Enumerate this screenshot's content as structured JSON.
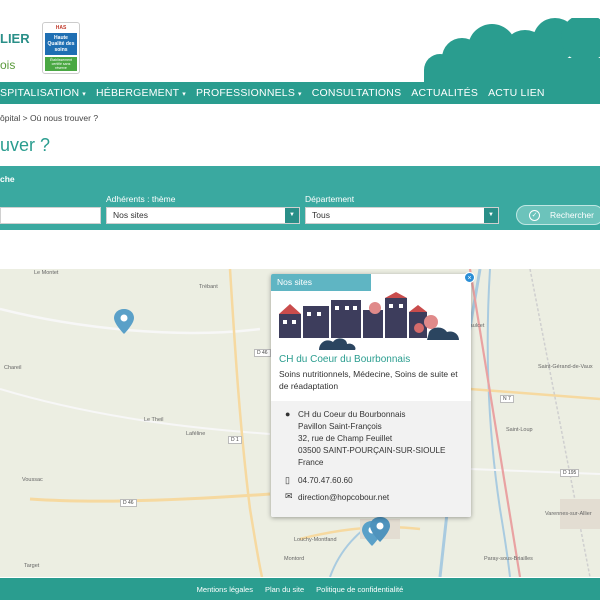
{
  "header": {
    "logo_line1": "LIER",
    "logo_line2": "ois",
    "has_badge": {
      "top": "HAS",
      "middle": "Haute Qualité des soins",
      "bottom": "Établissement certifié sans réserve"
    }
  },
  "nav": {
    "items": [
      {
        "label": "SPITALISATION",
        "has_caret": true
      },
      {
        "label": "HÉBERGEMENT",
        "has_caret": true
      },
      {
        "label": "PROFESSIONNELS",
        "has_caret": true
      },
      {
        "label": "CONSULTATIONS",
        "has_caret": false
      },
      {
        "label": "ACTUALITÉS",
        "has_caret": false
      },
      {
        "label": "ACTU LIEN",
        "has_caret": false
      }
    ],
    "caret": "▾"
  },
  "breadcrumb": "ôpital > Où nous trouver ?",
  "page_title": "uver ?",
  "search": {
    "panel_label": "che",
    "field1": {
      "value": ""
    },
    "field2": {
      "label": "Adhérents : thème",
      "value": "Nos sites"
    },
    "field3": {
      "label": "Département",
      "value": "Tous"
    },
    "button_label": "Rechercher"
  },
  "map": {
    "labels": [
      "Le Montet",
      "Trébant",
      "Chareil",
      "Le Theil",
      "Laféline",
      "Voussac",
      "Louchy-Montfand",
      "Montord",
      "Target",
      "Saulcet",
      "Saint-Loup",
      "Paray-sous-Briailles",
      "Varennes-sur-Allier",
      "Saint-Gérand-de-Vaux"
    ],
    "roads": [
      "D 1",
      "D 46",
      "N 7",
      "D 195",
      "D 46"
    ]
  },
  "popup": {
    "tag": "Nos sites",
    "close": "×",
    "name": "CH du Coeur du Bourbonnais",
    "description": "Soins nutritionnels, Médecine, Soins de suite et de réadaptation",
    "address": [
      "CH du Coeur du Bourbonnais",
      "Pavillon Saint-François",
      "32, rue de Champ Feuillet",
      "03500 SAINT-POURÇAIN-SUR-SIOULE",
      "France"
    ],
    "phone": "04.70.47.60.60",
    "email": "direction@hopcobour.net"
  },
  "footer": {
    "links": [
      "Mentions légales",
      "Plan du site",
      "Politique de confidentialité"
    ]
  },
  "colors": {
    "primary": "#2a9d8f",
    "panel": "#3aa9a0",
    "map_bg": "#eceee2",
    "marker": "#5aa0c8"
  }
}
